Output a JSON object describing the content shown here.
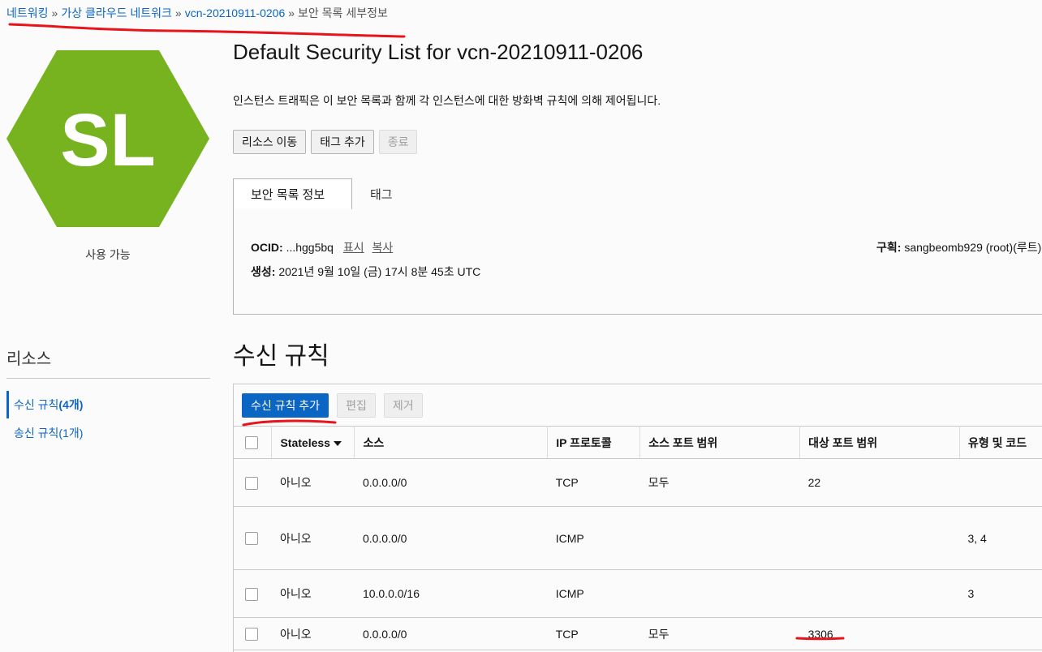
{
  "breadcrumb": {
    "items": [
      "네트워킹",
      "가상 클라우드 네트워크",
      "vcn-20210911-0206"
    ],
    "separator": "»",
    "current": "보안 목록 세부정보"
  },
  "logo": {
    "text": "SL",
    "color": "#77b31f"
  },
  "status": "사용 가능",
  "page_title": "Default Security List for vcn-20210911-0206",
  "description": "인스턴스 트래픽은 이 보안 목록과 함께 각 인스턴스에 대한 방화벽 규칙에 의해 제어됩니다.",
  "actions": {
    "move": "리소스 이동",
    "add_tags": "태그 추가",
    "terminate": "종료"
  },
  "tabs": {
    "info": "보안 목록 정보",
    "tags": "태그"
  },
  "info": {
    "ocid_label": "OCID:",
    "ocid_value": "...hgg5bq",
    "show_link": "표시",
    "copy_link": "복사",
    "created_label": "생성:",
    "created_value": "2021년 9월 10일 (금) 17시 8분 45초 UTC",
    "compartment_label": "구획:",
    "compartment_value": "sangbeomb929 (root)(루트)"
  },
  "resources": {
    "title": "리소스",
    "ingress": {
      "label": "수신 규칙",
      "count": "(4개)"
    },
    "egress": {
      "label": "송신 규칙",
      "count": "(1개)"
    }
  },
  "section_title": "수신 규칙",
  "toolbar": {
    "add": "수신 규칙 추가",
    "edit": "편집",
    "remove": "제거"
  },
  "table": {
    "headers": [
      "Stateless",
      "소스",
      "IP 프로토콜",
      "소스 포트 범위",
      "대상 포트 범위",
      "유형 및 코드"
    ],
    "rows": [
      {
        "stateless": "아니오",
        "source": "0.0.0.0/0",
        "protocol": "TCP",
        "src_port": "모두",
        "dst_port": "22",
        "type_code": ""
      },
      {
        "stateless": "아니오",
        "source": "0.0.0.0/0",
        "protocol": "ICMP",
        "src_port": "",
        "dst_port": "",
        "type_code": "3, 4"
      },
      {
        "stateless": "아니오",
        "source": "10.0.0.0/16",
        "protocol": "ICMP",
        "src_port": "",
        "dst_port": "",
        "type_code": "3"
      },
      {
        "stateless": "아니오",
        "source": "0.0.0.0/0",
        "protocol": "TCP",
        "src_port": "모두",
        "dst_port": "3306",
        "type_code": ""
      }
    ]
  },
  "colors": {
    "link": "#0b66c3",
    "annotation": "#e8141c",
    "primary": "#0b66c3"
  }
}
